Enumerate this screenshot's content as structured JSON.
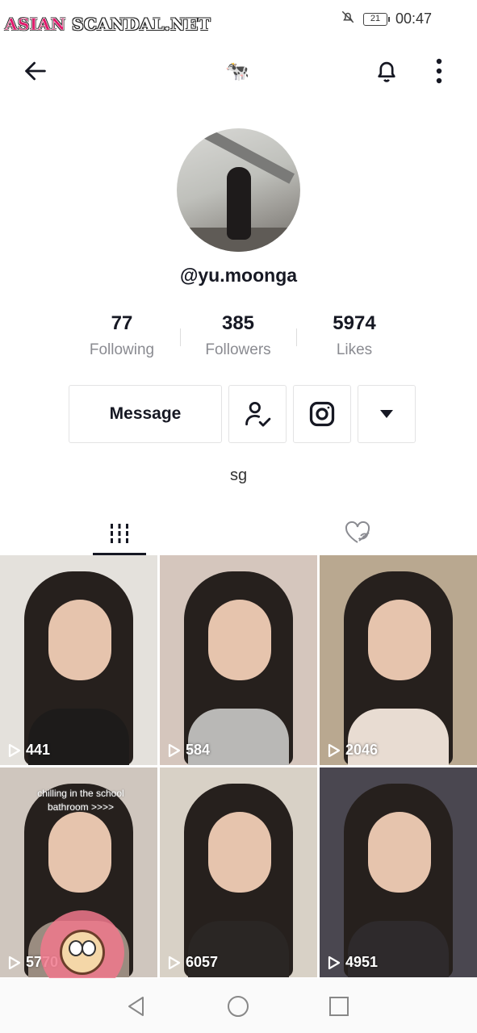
{
  "status_bar": {
    "watermark_part1": "ASIAN",
    "watermark_part2": " SCANDAL.NET",
    "battery": "21",
    "time": "00:47"
  },
  "top_nav": {
    "title_emoji": "🐄",
    "back_icon": "arrow-left-icon",
    "bell_icon": "bell-icon",
    "more_icon": "more-vertical-icon"
  },
  "profile": {
    "handle": "@yu.moonga",
    "bio": "sg",
    "stats": [
      {
        "value": "77",
        "label": "Following"
      },
      {
        "value": "385",
        "label": "Followers"
      },
      {
        "value": "5974",
        "label": "Likes"
      }
    ]
  },
  "actions": {
    "message_label": "Message",
    "following_icon": "user-check-icon",
    "instagram_icon": "instagram-icon",
    "dropdown_icon": "caret-down-icon"
  },
  "tabs": {
    "videos_icon": "grid-bars-icon",
    "liked_icon": "heart-hidden-icon"
  },
  "videos": [
    {
      "views": "441",
      "bg": "#e4e1dc",
      "body": "#1d1b1a",
      "text": ""
    },
    {
      "views": "584",
      "bg": "#d5c6bd",
      "body": "#b9b8b6",
      "text": ""
    },
    {
      "views": "2046",
      "bg": "#b9a890",
      "body": "#e8dcd2",
      "text": ""
    },
    {
      "views": "5770",
      "bg": "#cfc6be",
      "body": "#9a8c80",
      "text": "chilling in the school bathroom >>>>"
    },
    {
      "views": "6057",
      "bg": "#d8d1c6",
      "body": "#2a2624",
      "text": ""
    },
    {
      "views": "4951",
      "bg": "#4a4750",
      "body": "#2e2a2c",
      "text": ""
    }
  ]
}
